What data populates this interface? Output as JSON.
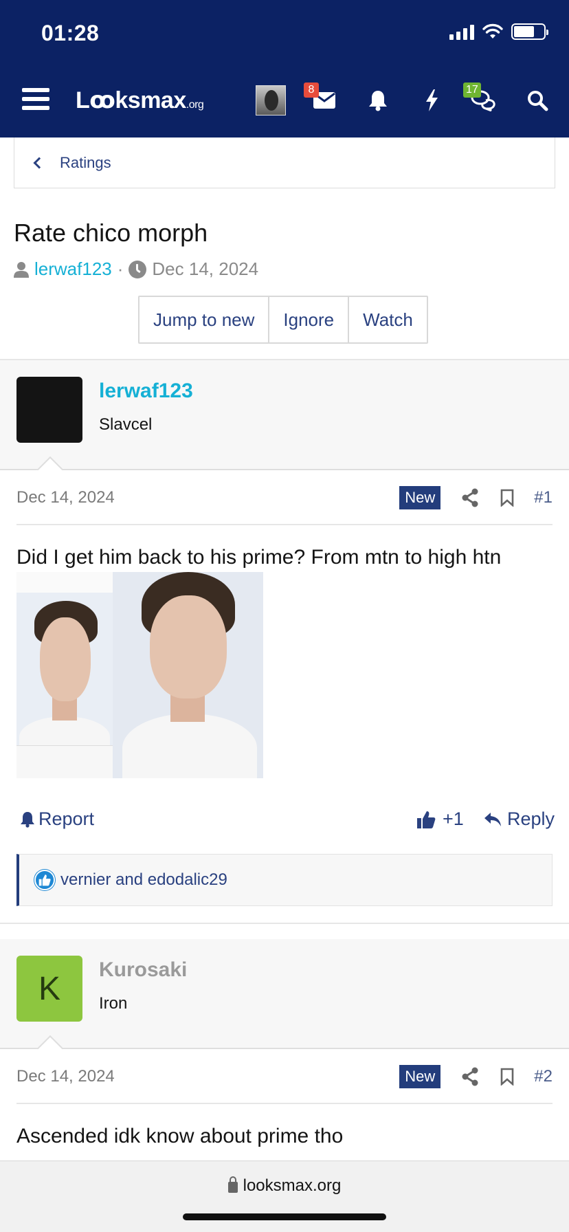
{
  "status_bar": {
    "time": "01:28"
  },
  "header": {
    "logo_main": "Lꝏksmax",
    "logo_suffix": ".org",
    "inbox_badge": "8",
    "chat_badge": "17"
  },
  "breadcrumb": {
    "label": "Ratings"
  },
  "thread": {
    "title": "Rate chico morph",
    "author": "lerwaf123",
    "separator": "·",
    "date": "Dec 14, 2024",
    "buttons": {
      "jump": "Jump to new",
      "ignore": "Ignore",
      "watch": "Watch"
    }
  },
  "posts": [
    {
      "username": "lerwaf123",
      "user_title": "Slavcel",
      "date": "Dec 14, 2024",
      "new_label": "New",
      "number": "#1",
      "body": "Did I get him back to his prime? From mtn to high htn",
      "report_label": "Report",
      "like_count": "+1",
      "reply_label": "Reply",
      "reactions": "vernier and edodalic29"
    },
    {
      "username": "Kurosaki",
      "avatar_letter": "K",
      "user_title": "Iron",
      "date": "Dec 14, 2024",
      "new_label": "New",
      "number": "#2",
      "body": "Ascended idk know about prime tho"
    }
  ],
  "browser": {
    "url": "looksmax.org"
  },
  "colors": {
    "header_bg": "#0c2264",
    "link": "#2a4180",
    "author": "#15b0d5",
    "new_badge": "#233d7c",
    "avatar_k": "#8dc63f"
  }
}
